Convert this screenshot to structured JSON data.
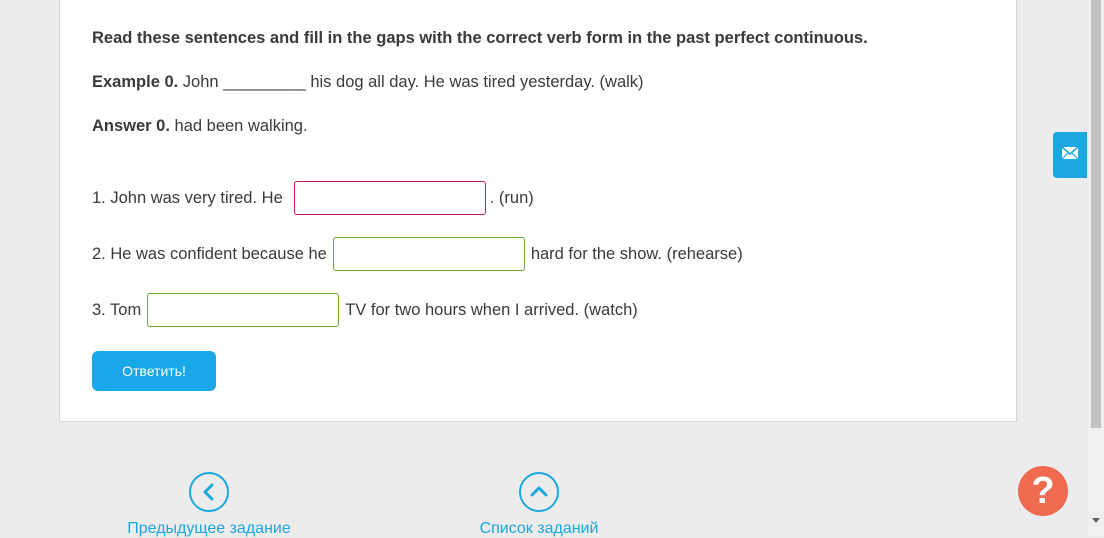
{
  "task": {
    "instruction": "Read these sentences and fill in the gaps with the correct verb form in the past perfect continuous.",
    "example_label": "Example 0.",
    "example_text": " John _________ his dog all day. He was tired yesterday. (walk)",
    "answer_label": "Answer 0.",
    "answer_text": " had been walking."
  },
  "questions": [
    {
      "before": "1. John was very tired. He",
      "after": ". (run)",
      "value": ""
    },
    {
      "before": "2. He was confident because he",
      "after": "hard for the show. (rehearse)",
      "value": ""
    },
    {
      "before": "3. Tom",
      "after": "TV for two hours when I arrived. (watch)",
      "value": ""
    }
  ],
  "submit_label": "Ответить!",
  "nav": {
    "prev_label": "Предыдущее задание",
    "list_label": "Список заданий"
  },
  "help_label": "?",
  "icons": {
    "mail": "mail-icon",
    "prev": "chevron-left-icon",
    "list": "chevron-up-icon"
  },
  "colors": {
    "accent": "#1aa7e8",
    "help": "#f06a4f",
    "invalid_border": "#c2185b",
    "valid_border": "#6aa52c"
  }
}
